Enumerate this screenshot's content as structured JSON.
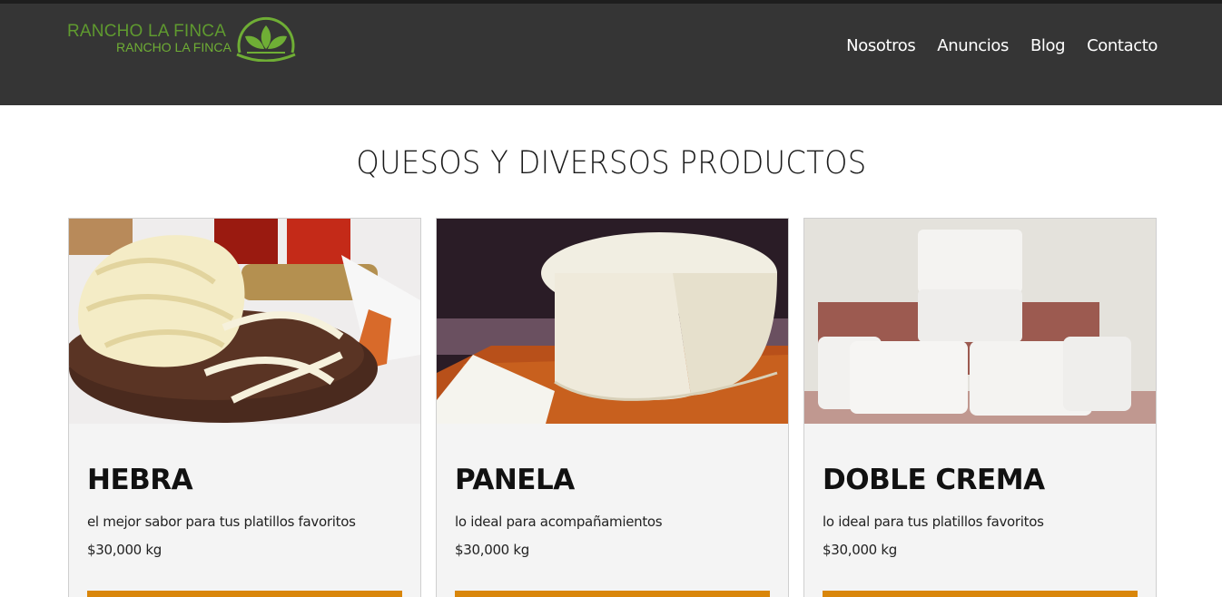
{
  "brand": {
    "name_line1": "RANCHO LA FINCA",
    "name_line2": "RANCHO LA FINCA",
    "logo_icon": "leaf-logo-icon"
  },
  "nav": {
    "items": [
      "Nosotros",
      "Anuncios",
      "Blog",
      "Contacto"
    ]
  },
  "section": {
    "title": "QUESOS Y DIVERSOS PRODUCTOS"
  },
  "products": [
    {
      "name": "HEBRA",
      "description": "el mejor sabor para tus platillos favoritos",
      "price": "$30,000 kg",
      "image": "string-cheese-photo"
    },
    {
      "name": "PANELA",
      "description": "lo ideal para acompañamientos",
      "price": "$30,000 kg",
      "image": "panela-cheese-photo"
    },
    {
      "name": "DOBLE CREMA",
      "description": "lo ideal para tus platillos favoritos",
      "price": "$30,000 kg",
      "image": "doble-crema-cheese-photo"
    }
  ],
  "colors": {
    "header_bg": "#353535",
    "brand_green": "#6fae35",
    "button_orange": "#d9860a",
    "card_bg": "#f4f4f4"
  }
}
